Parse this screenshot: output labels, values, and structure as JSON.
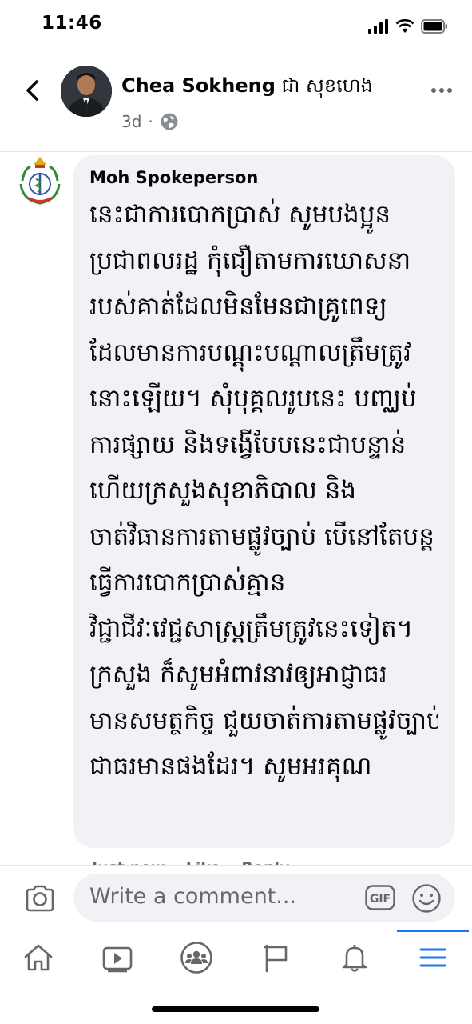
{
  "status_bar": {
    "time": "11:46"
  },
  "post_header": {
    "author_name": "Chea Sokheng",
    "author_name_khmer": "ជា សុខហេង",
    "timestamp": "3d",
    "separator": "·",
    "privacy_icon": "globe-icon",
    "back_icon": "chevron-left-icon",
    "more_icon": "more-horizontal-icon"
  },
  "comment": {
    "author": "Moh Spokeperson",
    "lines": [
      "នេះជាការបោកប្រាស់ សូមបងប្អូន",
      "ប្រជាពលរដ្ឋ កុំជឿតាមការឃោសនា",
      "របស់គាត់ដែលមិនមែនជាគ្រូពេទ្យ",
      "ដែលមានការបណ្តុះបណ្តាលត្រឹមត្រូវ",
      "នោះឡើយ។ សុំបុគ្គលរូបនេះ បញ្ឈប់",
      "ការផ្សាយ និងទង្វើបែបនេះជាបន្ទាន់",
      "ហើយក្រសួងសុខាភិបាល និង",
      "ចាត់វិធានការតាមផ្លូវច្បាប់ បើនៅតែបន្ត",
      "ធ្វើការបោកប្រាស់គ្មាន",
      "វិជ្ជាជីវៈវេជ្ជសាស្ត្រត្រឹមត្រូវនេះទៀត។",
      "ក្រសួង ក៏សូមអំពាវនាវឲ្យអាជ្ញាធរ",
      "មានសមត្ថកិច្ច ជួយចាត់ការតាមផ្លូវច្បាប់",
      "ជាធរមានផងដែរ។ សូមអរគុណ"
    ],
    "actions": {
      "time": "Just now",
      "like": "Like",
      "reply": "Reply"
    }
  },
  "composer": {
    "placeholder": "Write a comment...",
    "camera_icon": "camera-icon",
    "gif_label": "GIF",
    "emoji_icon": "emoji-icon"
  },
  "bottom_nav": {
    "items": [
      "home-icon",
      "watch-icon",
      "groups-icon",
      "pages-flag-icon",
      "notifications-bell-icon",
      "menu-icon"
    ],
    "active": "menu-icon"
  },
  "colors": {
    "accent": "#1877f2",
    "bubble": "#f0f2f5",
    "secondary_text": "#65676b"
  }
}
